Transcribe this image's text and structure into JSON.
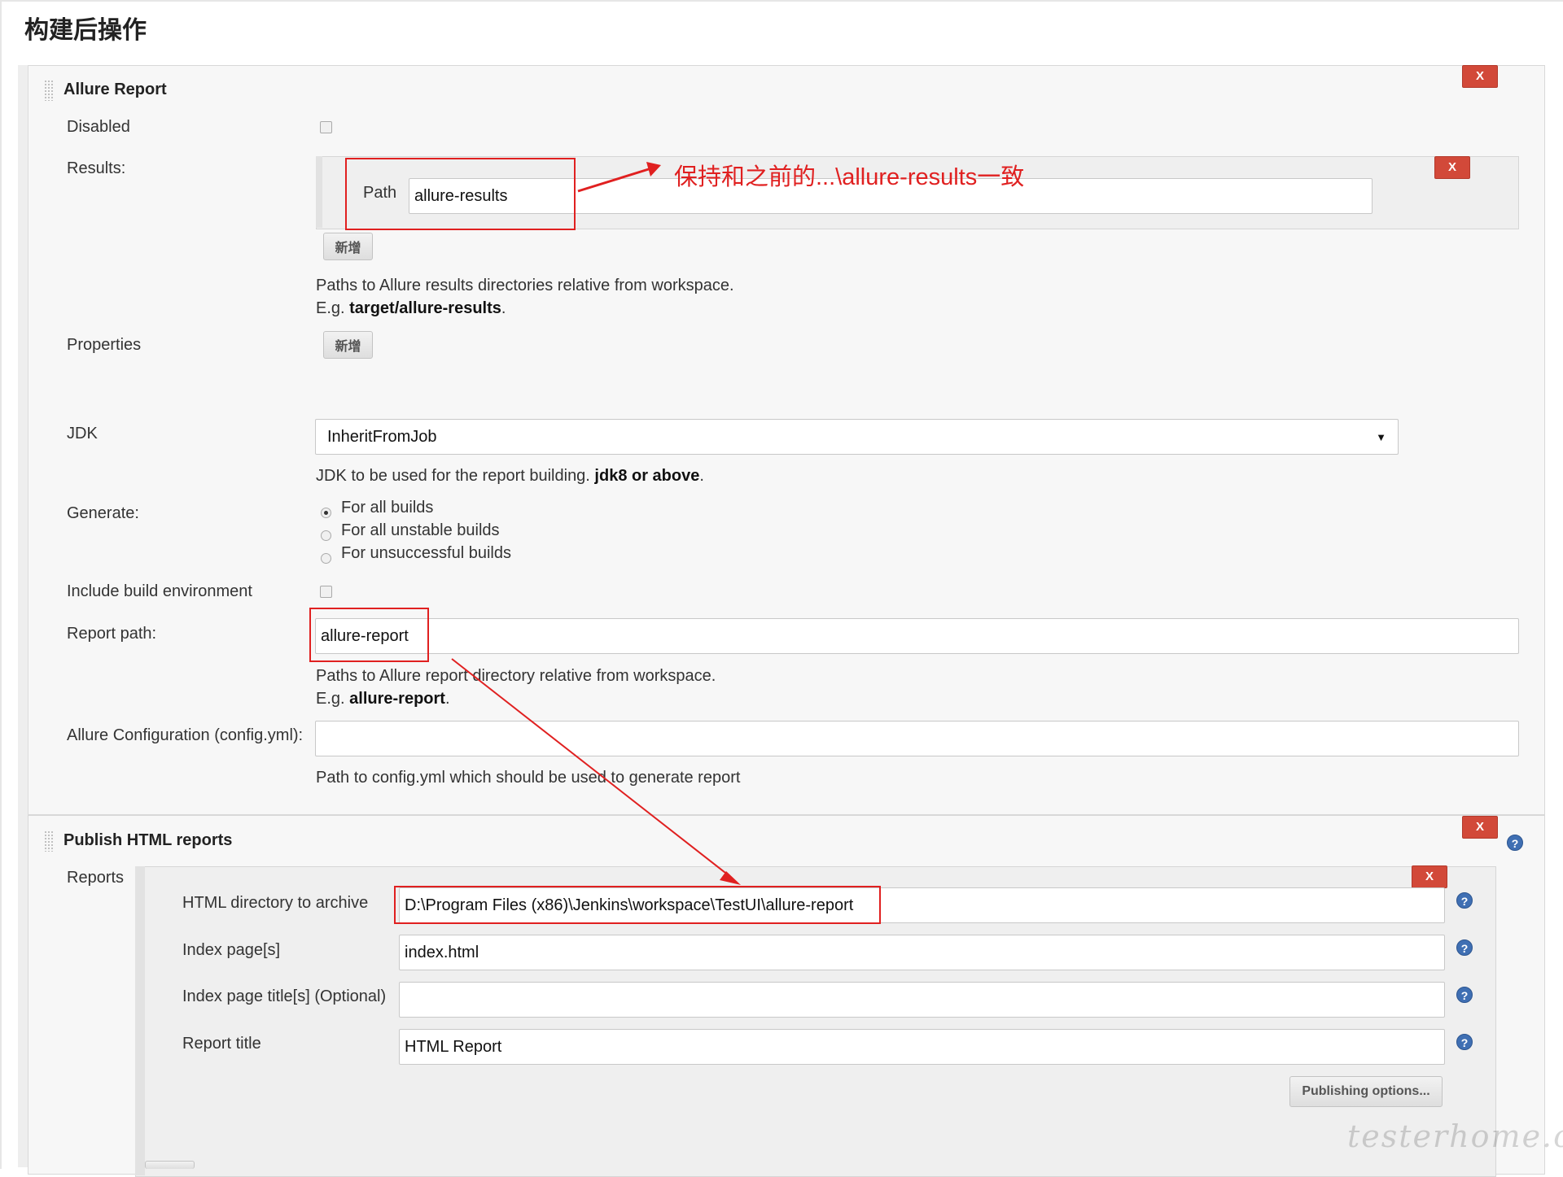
{
  "page": {
    "section_title": "构建后操作"
  },
  "allure": {
    "title": "Allure Report",
    "remove_label": "X",
    "disabled_label": "Disabled",
    "results_label": "Results:",
    "path_label": "Path",
    "path_value": "allure-results",
    "add_label": "新增",
    "results_help_line1": "Paths to Allure results directories relative from workspace.",
    "results_help_eg_prefix": "E.g. ",
    "results_help_eg_value": "target/allure-results",
    "results_help_eg_suffix": ".",
    "properties_label": "Properties",
    "jdk_label": "JDK",
    "jdk_value": "InheritFromJob",
    "jdk_help_prefix": "JDK to be used for the report building. ",
    "jdk_help_bold": "jdk8 or above",
    "jdk_help_suffix": ".",
    "generate_label": "Generate:",
    "generate_options": [
      "For all builds",
      "For all unstable builds",
      "For unsuccessful builds"
    ],
    "generate_selected": "For all builds",
    "include_env_label": "Include build environment",
    "report_path_label": "Report path:",
    "report_path_value": "allure-report",
    "report_help_line1": "Paths to Allure report directory relative from workspace.",
    "report_help_eg_prefix": "E.g. ",
    "report_help_eg_value": "allure-report",
    "report_help_eg_suffix": ".",
    "config_label": "Allure Configuration (config.yml):",
    "config_value": "",
    "config_help": "Path to config.yml which should be used to generate report"
  },
  "annotation": {
    "text": "保持和之前的...\\allure-results一致",
    "color": "#e02020"
  },
  "html_publisher": {
    "title": "Publish HTML reports",
    "remove_label": "X",
    "reports_label": "Reports",
    "dir_label": "HTML directory to archive",
    "dir_value": "D:\\Program Files (x86)\\Jenkins\\workspace\\TestUI\\allure-report",
    "index_label": "Index page[s]",
    "index_value": "index.html",
    "index_title_label": "Index page title[s] (Optional)",
    "index_title_value": "",
    "report_title_label": "Report title",
    "report_title_value": "HTML Report",
    "publishing_options_label": "Publishing options...",
    "help_glyph": "?"
  },
  "watermark": "testerhome.com",
  "colors": {
    "remove_button": "#d24939",
    "annotation_red": "#e02020",
    "help_blue": "#3f6fb3"
  }
}
